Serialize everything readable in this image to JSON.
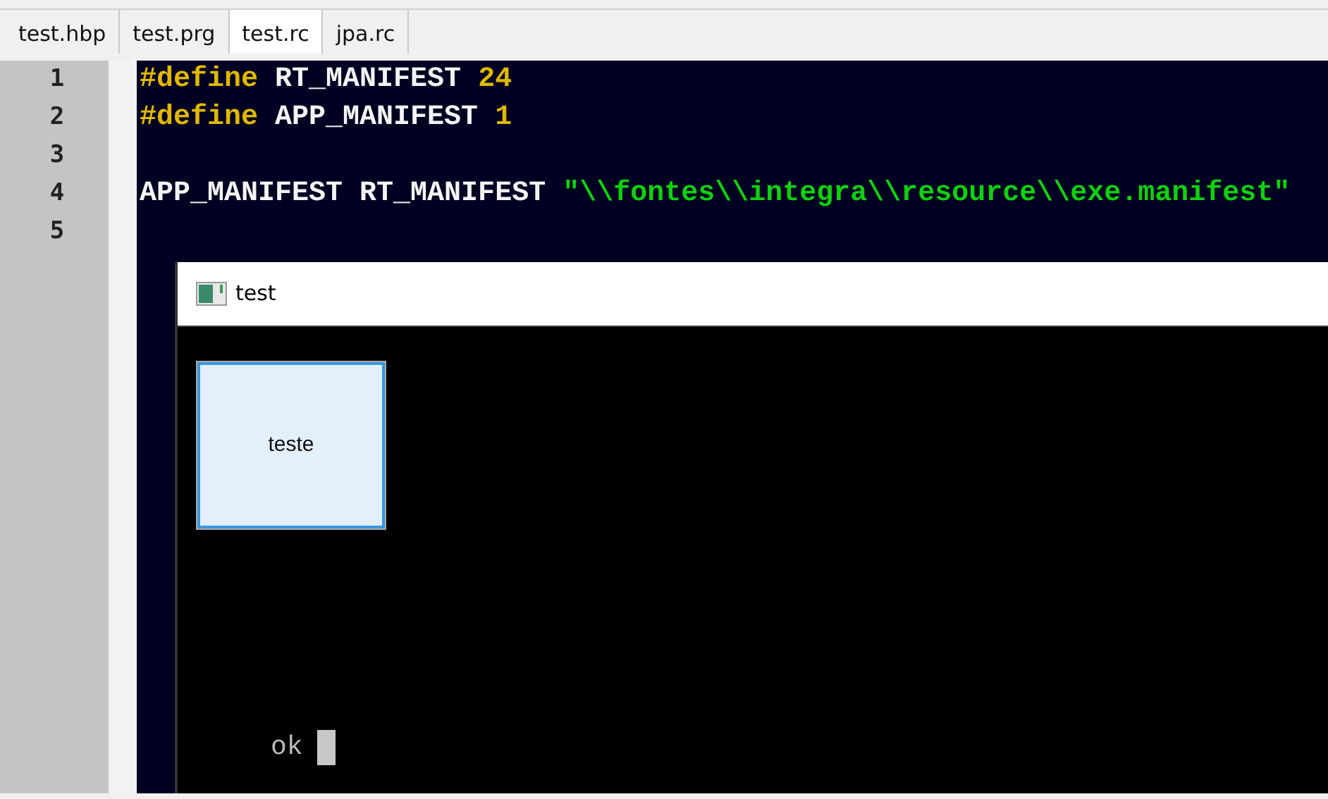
{
  "tabs": [
    {
      "label": "test.hbp",
      "selected": false
    },
    {
      "label": "test.prg",
      "selected": false
    },
    {
      "label": "test.rc",
      "selected": true
    },
    {
      "label": "jpa.rc",
      "selected": false
    }
  ],
  "editor": {
    "lines": [
      {
        "number": "1",
        "tokens": [
          {
            "kind": "directive",
            "text": "#define"
          },
          {
            "kind": "ident",
            "text": "RT_MANIFEST"
          },
          {
            "kind": "number",
            "text": "24"
          }
        ]
      },
      {
        "number": "2",
        "tokens": [
          {
            "kind": "directive",
            "text": "#define"
          },
          {
            "kind": "ident",
            "text": "APP_MANIFEST"
          },
          {
            "kind": "number",
            "text": "1"
          }
        ]
      },
      {
        "number": "3"
      },
      {
        "number": "4",
        "tokens": [
          {
            "kind": "ident",
            "text": "APP_MANIFEST"
          },
          {
            "kind": "ident",
            "text": "RT_MANIFEST"
          },
          {
            "kind": "string",
            "text": "\"\\\\fontes\\\\integra\\\\resource\\\\exe.manifest\""
          }
        ]
      },
      {
        "number": "5"
      }
    ]
  },
  "app_window": {
    "title": "test",
    "button": {
      "label": "teste",
      "focused": true
    },
    "console_text": "ok"
  }
}
